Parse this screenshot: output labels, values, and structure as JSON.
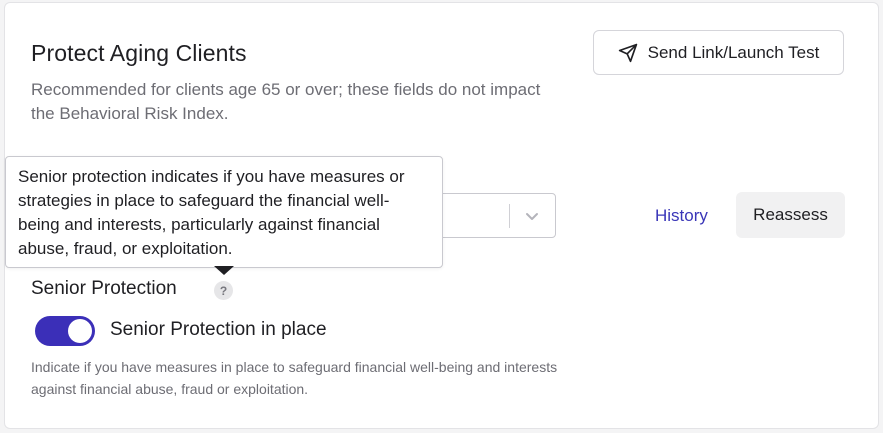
{
  "card": {
    "title": "Protect Aging Clients",
    "subtitle": "Recommended for clients age 65 or over; these fields do not impact the Behavioral Risk Index."
  },
  "actions": {
    "send_link_label": "Send Link/Launch Test",
    "history_label": "History",
    "reassess_label": "Reassess"
  },
  "tooltip": {
    "text": "Senior protection indicates if you have measures or strategies in place to safeguard the financial well-being and interests, particularly against financial abuse, fraud, or exploitation."
  },
  "senior_protection": {
    "label": "Senior Protection",
    "help_glyph": "?",
    "toggle_on": true,
    "toggle_label": "Senior Protection in place",
    "helper_text": "Indicate if you have measures in place to safeguard financial well-being and interests against financial abuse, fraud or exploitation."
  },
  "colors": {
    "accent": "#3b2fb8",
    "link": "#3a36b8",
    "muted_text": "#6d6d74"
  },
  "icons": {
    "send": "send-icon",
    "chevron": "chevron-down-icon",
    "help": "help-icon"
  }
}
